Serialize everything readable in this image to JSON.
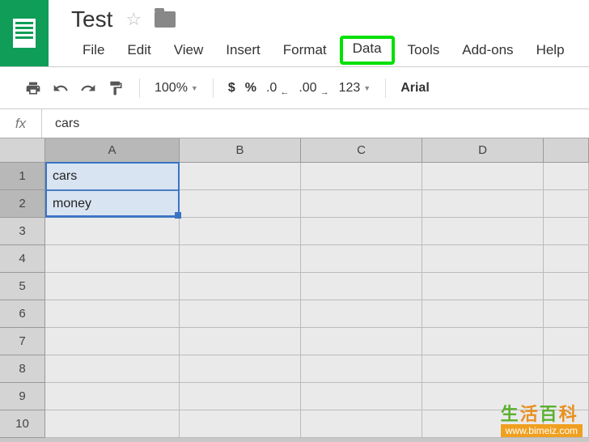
{
  "doc": {
    "title": "Test"
  },
  "menu": {
    "file": "File",
    "edit": "Edit",
    "view": "View",
    "insert": "Insert",
    "format": "Format",
    "data": "Data",
    "tools": "Tools",
    "addons": "Add-ons",
    "help": "Help"
  },
  "toolbar": {
    "zoom": "100%",
    "currency": "$",
    "percent": "%",
    "dec_decrease": ".0",
    "dec_increase": ".00",
    "numfmt": "123",
    "font": "Arial"
  },
  "formula": {
    "fx": "fx",
    "value": "cars"
  },
  "columns": [
    "A",
    "B",
    "C",
    "D"
  ],
  "rows": [
    "1",
    "2",
    "3",
    "4",
    "5",
    "6",
    "7",
    "8",
    "9",
    "10"
  ],
  "cells": {
    "A1": "cars",
    "A2": "money"
  },
  "watermark": {
    "text": "生活百科",
    "url": "www.bimeiz.com"
  }
}
